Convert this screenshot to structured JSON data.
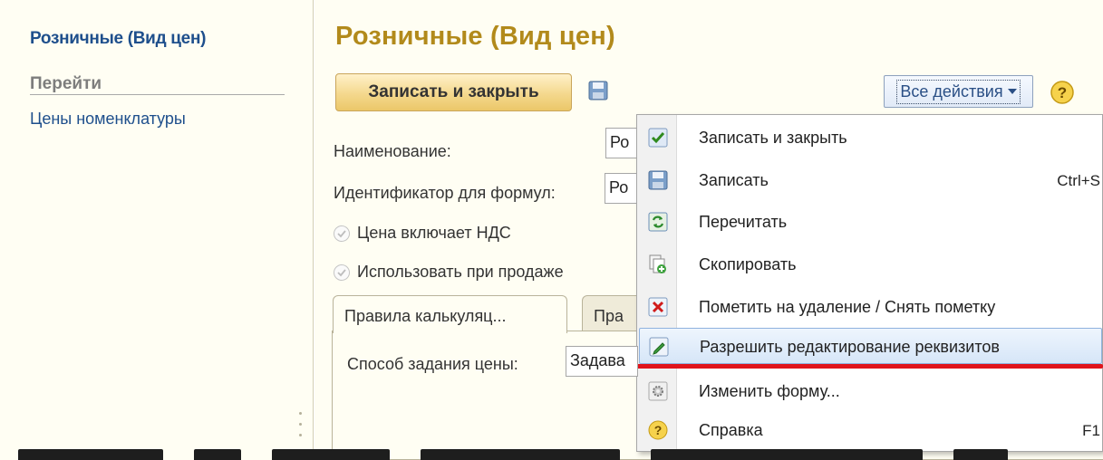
{
  "left_panel": {
    "title": "Розничные (Вид цен)",
    "section": "Перейти",
    "links": [
      "Цены номенклатуры"
    ]
  },
  "form": {
    "title": "Розничные (Вид цен)",
    "save_close_label": "Записать и закрыть",
    "all_actions_label": "Все действия",
    "name_label": "Наименование:",
    "name_value": "Ро",
    "identifier_label": "Идентификатор для формул:",
    "identifier_value": "Ро",
    "check_vat_label": "Цена включает НДС",
    "check_sale_label": "Использовать при продаже",
    "tabs": [
      {
        "label": "Правила калькуляц...",
        "active": true
      },
      {
        "label": "Пра",
        "active": false
      }
    ],
    "price_method_label": "Способ задания цены:",
    "price_method_value": "Задава"
  },
  "menu": {
    "items": [
      {
        "label": "Записать и закрыть",
        "shortcut": "",
        "icon": "check-save-icon"
      },
      {
        "label": "Записать",
        "shortcut": "Ctrl+S",
        "icon": "floppy-icon"
      },
      {
        "label": "Перечитать",
        "shortcut": "",
        "icon": "refresh-icon"
      },
      {
        "label": "Скопировать",
        "shortcut": "",
        "icon": "copy-icon"
      },
      {
        "label": "Пометить на удаление / Снять пометку",
        "shortcut": "",
        "icon": "delete-mark-icon"
      },
      {
        "label": "Разрешить редактирование реквизитов",
        "shortcut": "",
        "icon": "edit-pencil-icon",
        "highlighted": true
      },
      {
        "label": "Изменить форму...",
        "shortcut": "",
        "icon": "gear-icon"
      },
      {
        "label": "Справка",
        "shortcut": "F1",
        "icon": "help-icon"
      }
    ]
  },
  "colors": {
    "title": "#b28a1b",
    "link": "#1e4f8c",
    "annotation": "#e0141c",
    "highlight": "#d6e6f8"
  }
}
